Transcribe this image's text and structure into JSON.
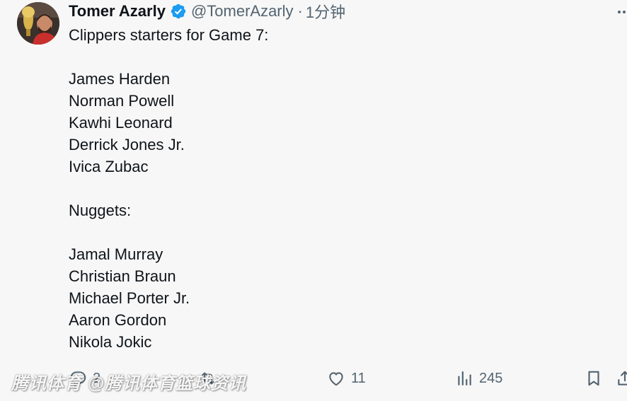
{
  "author": {
    "display_name": "Tomer Azarly",
    "handle": "@TomerAzarly",
    "separator": "·",
    "time": "1分钟",
    "verified": true
  },
  "tweet": {
    "text": "Clippers starters for Game 7:\n\nJames Harden\nNorman Powell\nKawhi Leonard\nDerrick Jones Jr.\nIvica Zubac\n\nNuggets:\n\nJamal Murray\nChristian Braun\nMichael Porter Jr.\nAaron Gordon\nNikola Jokic"
  },
  "actions": {
    "replies": "2",
    "reposts": "",
    "likes": "11",
    "views": "245"
  },
  "watermark": "腾讯体育 @腾讯体育篮球资讯",
  "icons": {
    "verified": "verified-badge-icon",
    "more": "more-icon",
    "reply": "reply-icon",
    "repost": "repost-icon",
    "like": "heart-icon",
    "views": "views-chart-icon",
    "bookmark": "bookmark-icon",
    "share": "share-icon"
  },
  "colors": {
    "verified": "#1d9bf0",
    "text": "#0f1419",
    "secondary": "#536471",
    "background": "#f7f7f7"
  }
}
